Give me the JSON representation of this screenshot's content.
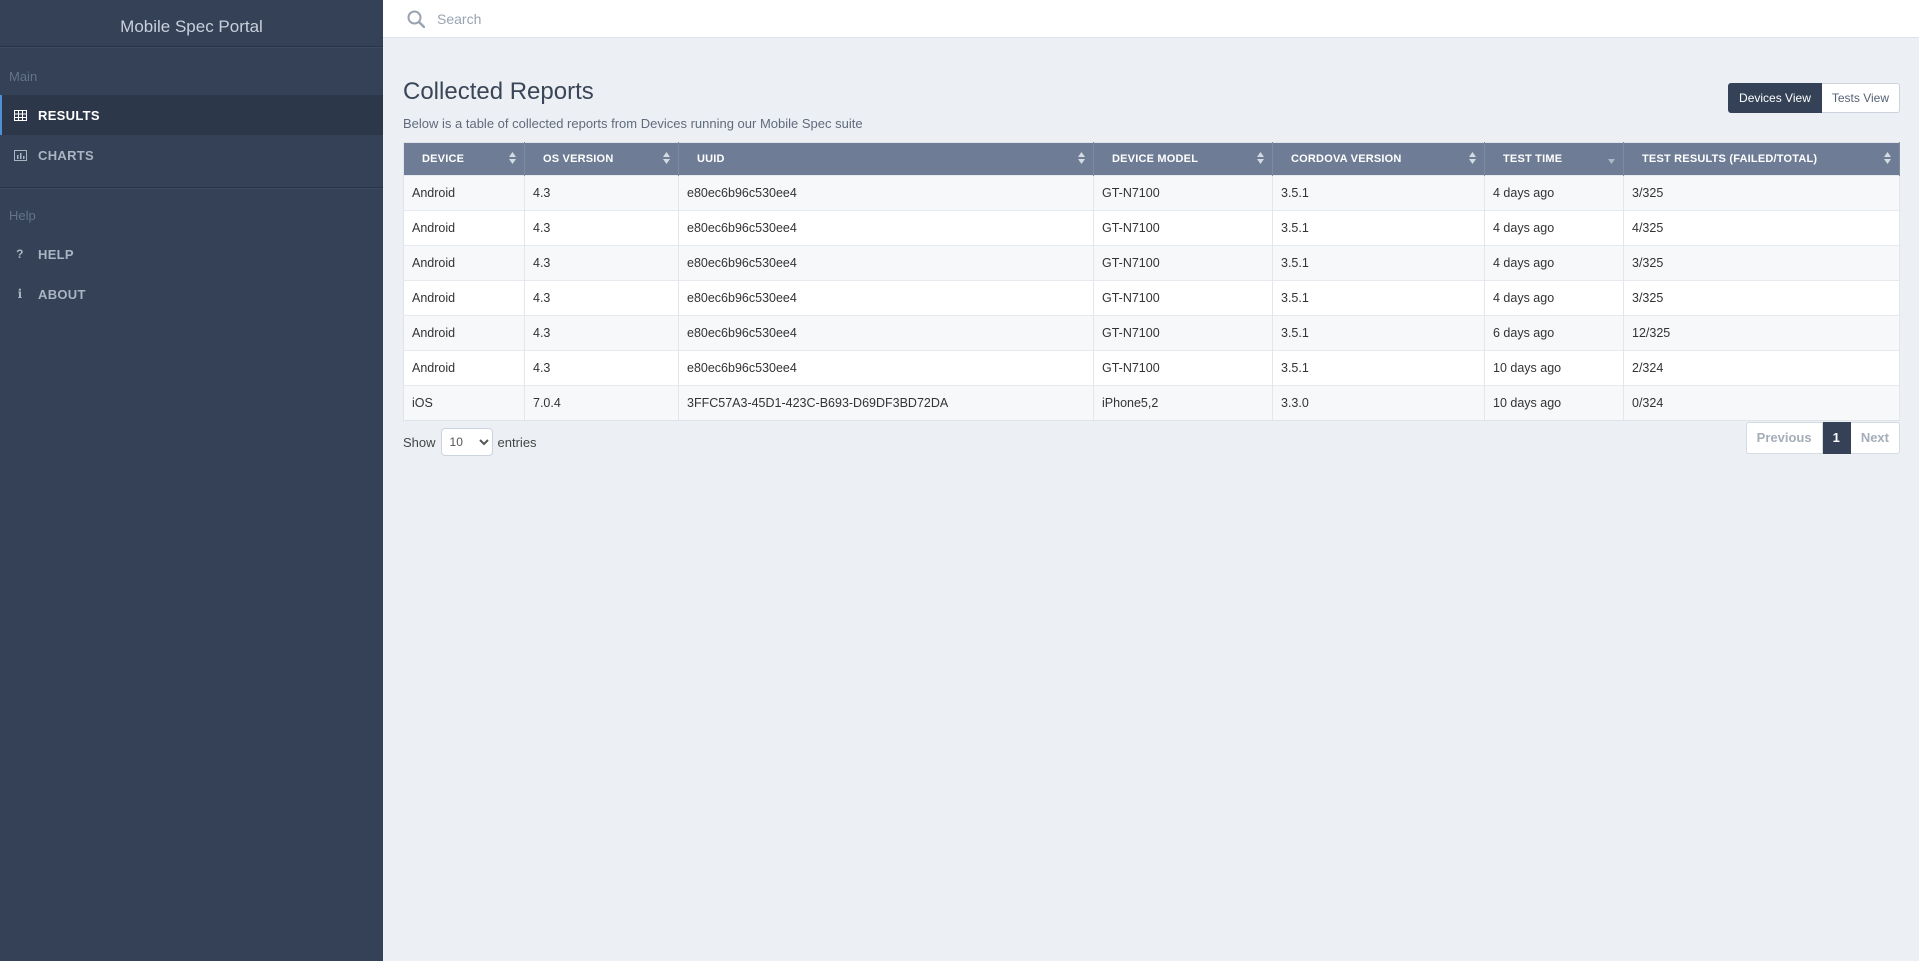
{
  "app": {
    "title": "Mobile Spec Portal"
  },
  "sidebar": {
    "sections": [
      {
        "label": "Main",
        "items": [
          {
            "label": "RESULTS",
            "icon": "grid-icon",
            "active": true
          },
          {
            "label": "CHARTS",
            "icon": "bar-chart-icon",
            "active": false
          }
        ]
      },
      {
        "label": "Help",
        "items": [
          {
            "label": "HELP",
            "icon": "question-icon",
            "active": false
          },
          {
            "label": "ABOUT",
            "icon": "info-icon",
            "active": false
          }
        ]
      }
    ]
  },
  "search": {
    "placeholder": "Search",
    "value": ""
  },
  "page": {
    "title": "Collected Reports",
    "subtitle": "Below is a table of collected reports from Devices running our Mobile Spec suite"
  },
  "view_toggle": {
    "devices_label": "Devices View",
    "tests_label": "Tests View",
    "selected": "Devices View"
  },
  "table": {
    "columns": [
      "DEVICE",
      "OS VERSION",
      "UUID",
      "DEVICE MODEL",
      "CORDOVA VERSION",
      "TEST TIME",
      "TEST RESULTS (FAILED/TOTAL)"
    ],
    "rows": [
      [
        "Android",
        "4.3",
        "e80ec6b96c530ee4",
        "GT-N7100",
        "3.5.1",
        "4 days ago",
        "3/325"
      ],
      [
        "Android",
        "4.3",
        "e80ec6b96c530ee4",
        "GT-N7100",
        "3.5.1",
        "4 days ago",
        "4/325"
      ],
      [
        "Android",
        "4.3",
        "e80ec6b96c530ee4",
        "GT-N7100",
        "3.5.1",
        "4 days ago",
        "3/325"
      ],
      [
        "Android",
        "4.3",
        "e80ec6b96c530ee4",
        "GT-N7100",
        "3.5.1",
        "4 days ago",
        "3/325"
      ],
      [
        "Android",
        "4.3",
        "e80ec6b96c530ee4",
        "GT-N7100",
        "3.5.1",
        "6 days ago",
        "12/325"
      ],
      [
        "Android",
        "4.3",
        "e80ec6b96c530ee4",
        "GT-N7100",
        "3.5.1",
        "10 days ago",
        "2/324"
      ],
      [
        "iOS",
        "7.0.4",
        "3FFC57A3-45D1-423C-B693-D69DF3BD72DA",
        "iPhone5,2",
        "3.3.0",
        "10 days ago",
        "0/324"
      ]
    ]
  },
  "length": {
    "show_label": "Show",
    "entries_label": "entries",
    "selected": "10",
    "options": [
      "10"
    ]
  },
  "pagination": {
    "previous_label": "Previous",
    "current_page": "1",
    "next_label": "Next"
  },
  "colors": {
    "sidebar": "#344156",
    "header": "#6e7d95",
    "accent": "#4f8fd6",
    "background": "#ecf0f4"
  }
}
